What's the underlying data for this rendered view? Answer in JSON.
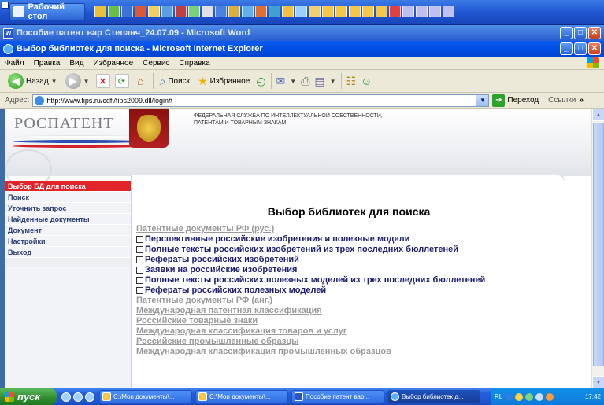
{
  "quick_bar": {
    "desktop_label": "Рабочий стол"
  },
  "word_window": {
    "title": "Пособие патент вар Степанч_24.07.09 - Microsoft Word"
  },
  "ie_window": {
    "title": "Выбор библиотек для поиска - Microsoft Internet Explorer"
  },
  "window_controls": {
    "minimize": "_",
    "maximize": "□",
    "close": "✕"
  },
  "menu": [
    "Файл",
    "Правка",
    "Вид",
    "Избранное",
    "Сервис",
    "Справка"
  ],
  "toolbar": {
    "back": "Назад",
    "search": "Поиск",
    "favorites": "Избранное"
  },
  "address": {
    "label": "Адрес:",
    "url": "http://www.fips.ru/cdfi/fips2009.dll/login#",
    "go": "Переход",
    "links": "Ссылки"
  },
  "banner": {
    "logo": "РОСПАТЕНТ",
    "agency_line1": "ФЕДЕРАЛЬНАЯ СЛУЖБА ПО ИНТЕЛЛЕКТУАЛЬНОЙ СОБСТВЕННОСТИ,",
    "agency_line2": "ПАТЕНТАМ И ТОВАРНЫМ ЗНАКАМ"
  },
  "sidebar": {
    "items": [
      {
        "label": "Выбор БД для поиска",
        "active": true
      },
      {
        "label": "Поиск"
      },
      {
        "label": "Уточнить запрос"
      },
      {
        "label": "Найденные документы"
      },
      {
        "label": "Документ"
      },
      {
        "label": "Настройки"
      },
      {
        "label": "Выход"
      }
    ]
  },
  "main": {
    "title": "Выбор библиотек для поиска",
    "group_ru": "Патентные документы РФ (рус.)",
    "checkboxes": [
      "Перспективные российские изобретения и полезные модели",
      "Полные тексты российских изобретений из трех последних бюллетеней",
      "Рефераты российских изобретений",
      "Заявки на российские изобретения",
      "Полные тексты российских полезных моделей из трех последних бюллетеней",
      "Рефераты российских полезных моделей"
    ],
    "other_groups": [
      "Патентные документы РФ (анг.)",
      "Международная патентная классификация",
      "Российские товарные знаки",
      "Международная классификация товаров и услуг",
      "Российские промышленные образцы",
      "Международная классификация промышленных образцов"
    ]
  },
  "taskbar": {
    "start": "пуск",
    "tasks": [
      {
        "label": "C:\\Мои документы\\...",
        "active": false
      },
      {
        "label": "C:\\Мои документы\\...",
        "active": false
      },
      {
        "label": "Пособие патент вар...",
        "active": false
      },
      {
        "label": "Выбор библиотек д...",
        "active": true
      }
    ],
    "lang": "RL",
    "clock": "17:42"
  }
}
